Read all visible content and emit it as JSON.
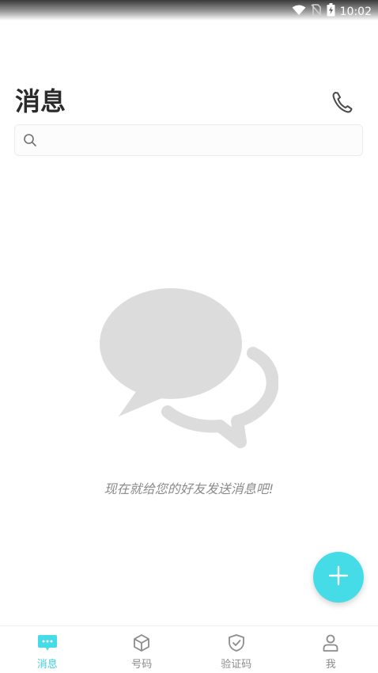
{
  "status_bar": {
    "time": "10:02",
    "icons": [
      "wifi-icon",
      "no-sim-icon",
      "battery-icon"
    ]
  },
  "header": {
    "title": "消息",
    "phone_icon": "phone-icon"
  },
  "search": {
    "placeholder": "",
    "value": "",
    "icon": "search-icon"
  },
  "empty_state": {
    "illustration": "chat-bubbles-icon",
    "message": "现在就给您的好友发送消息吧!"
  },
  "fab": {
    "icon": "plus-icon"
  },
  "bottom_nav": {
    "items": [
      {
        "label": "消息",
        "icon": "message-icon",
        "active": true
      },
      {
        "label": "号码",
        "icon": "box-icon",
        "active": false
      },
      {
        "label": "验证码",
        "icon": "shield-check-icon",
        "active": false
      },
      {
        "label": "我",
        "icon": "person-icon",
        "active": false
      }
    ]
  },
  "colors": {
    "accent": "#45dbe7",
    "active_label": "#3fcfe0",
    "inactive": "#8c8c8c",
    "illustration": "#dcdcdc"
  }
}
